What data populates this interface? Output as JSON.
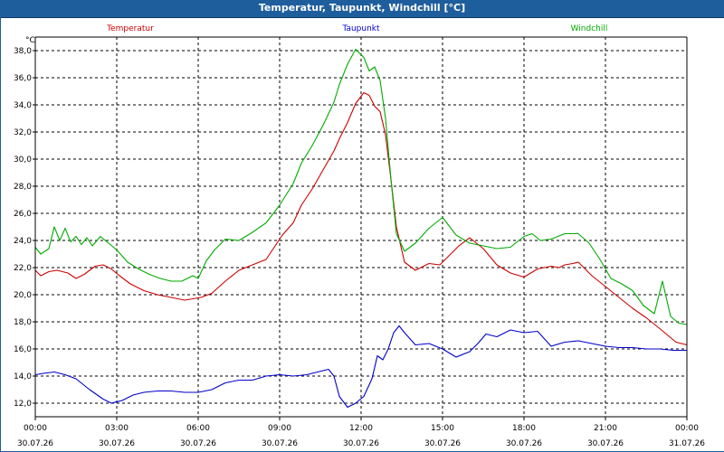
{
  "window": {
    "title": "Temperatur, Taupunkt, Windchill [°C]"
  },
  "chart_data": {
    "type": "line",
    "title": "Temperatur, Taupunkt, Windchill [°C]",
    "ylabel": "°C",
    "ylim": [
      11,
      39
    ],
    "yticks": [
      12.0,
      14.0,
      16.0,
      18.0,
      20.0,
      22.0,
      24.0,
      26.0,
      28.0,
      30.0,
      32.0,
      34.0,
      36.0,
      38.0
    ],
    "ytick_labels": [
      "12,0",
      "14,0",
      "16,0",
      "18,0",
      "20,0",
      "22,0",
      "24,0",
      "26,0",
      "28,0",
      "30,0",
      "32,0",
      "34,0",
      "36,0",
      "38,0"
    ],
    "xlim": [
      0,
      24
    ],
    "xticks": [
      0,
      3,
      6,
      9,
      12,
      15,
      18,
      21,
      24
    ],
    "xtick_time_labels": [
      "00:00",
      "03:00",
      "06:00",
      "09:00",
      "12:00",
      "15:00",
      "18:00",
      "21:00",
      "00:00"
    ],
    "xtick_date_labels": [
      "30.07.26",
      "30.07.26",
      "30.07.26",
      "30.07.26",
      "30.07.26",
      "30.07.26",
      "30.07.26",
      "30.07.26",
      "31.07.26"
    ],
    "grid": true,
    "legend_position": "top",
    "series": [
      {
        "name": "Temperatur",
        "color": "#cc0000",
        "x": [
          0,
          0.2,
          0.5,
          0.8,
          1.2,
          1.5,
          1.8,
          2.2,
          2.5,
          2.8,
          3.1,
          3.5,
          4,
          4.5,
          5,
          5.5,
          5.8,
          6.1,
          6.5,
          7,
          7.5,
          8,
          8.5,
          8.8,
          9.1,
          9.5,
          9.8,
          10.2,
          10.6,
          11,
          11.2,
          11.5,
          11.8,
          12.1,
          12.3,
          12.5,
          12.7,
          12.9,
          13.1,
          13.3,
          13.6,
          14,
          14.5,
          14.9,
          15.2,
          15.6,
          16,
          16.5,
          17,
          17.5,
          18,
          18.5,
          19,
          19.3,
          19.5,
          19.8,
          20,
          20.5,
          21,
          21.5,
          22,
          22.5,
          23,
          23.3,
          23.6,
          24
        ],
        "y": [
          21.8,
          21.4,
          21.7,
          21.8,
          21.6,
          21.2,
          21.5,
          22.1,
          22.2,
          21.9,
          21.4,
          20.8,
          20.3,
          20.0,
          19.8,
          19.6,
          19.7,
          19.8,
          20.1,
          21.0,
          21.8,
          22.2,
          22.6,
          23.5,
          24.4,
          25.3,
          26.6,
          27.8,
          29.2,
          30.6,
          31.5,
          32.7,
          34.1,
          34.9,
          34.7,
          33.9,
          33.5,
          31.8,
          28.5,
          25.0,
          22.4,
          21.8,
          22.3,
          22.2,
          22.8,
          23.6,
          24.2,
          23.4,
          22.2,
          21.6,
          21.3,
          21.9,
          22.1,
          22.0,
          22.2,
          22.3,
          22.4,
          21.4,
          20.6,
          19.8,
          19.0,
          18.3,
          17.5,
          17.0,
          16.5,
          16.3
        ]
      },
      {
        "name": "Taupunkt",
        "color": "#0000cc",
        "x": [
          0,
          0.3,
          0.7,
          1.1,
          1.5,
          2,
          2.5,
          2.8,
          3.2,
          3.6,
          4,
          4.5,
          5,
          5.5,
          6,
          6.5,
          7,
          7.5,
          8,
          8.5,
          9,
          9.5,
          10,
          10.4,
          10.8,
          11,
          11.2,
          11.5,
          11.8,
          12.1,
          12.4,
          12.6,
          12.8,
          13,
          13.2,
          13.4,
          13.6,
          14,
          14.5,
          15,
          15.5,
          16,
          16.3,
          16.6,
          17,
          17.5,
          18,
          18.5,
          19,
          19.5,
          20,
          20.5,
          21,
          21.5,
          22,
          22.5,
          23,
          23.5,
          24
        ],
        "y": [
          14.1,
          14.2,
          14.3,
          14.1,
          13.8,
          13.0,
          12.3,
          12.0,
          12.2,
          12.6,
          12.8,
          12.9,
          12.9,
          12.8,
          12.8,
          13.0,
          13.5,
          13.7,
          13.7,
          14.0,
          14.1,
          14.0,
          14.1,
          14.3,
          14.5,
          14.0,
          12.5,
          11.7,
          12.0,
          12.5,
          13.8,
          15.5,
          15.2,
          16.0,
          17.2,
          17.7,
          17.2,
          16.3,
          16.4,
          16.0,
          15.4,
          15.8,
          16.4,
          17.1,
          16.9,
          17.4,
          17.2,
          17.3,
          16.2,
          16.5,
          16.6,
          16.4,
          16.2,
          16.1,
          16.1,
          16.0,
          16.0,
          15.9,
          15.9
        ]
      },
      {
        "name": "Windchill",
        "color": "#00aa00",
        "x": [
          0,
          0.2,
          0.5,
          0.7,
          0.9,
          1.1,
          1.3,
          1.5,
          1.7,
          1.9,
          2.1,
          2.4,
          2.7,
          3,
          3.4,
          3.8,
          4.2,
          4.6,
          5,
          5.4,
          5.8,
          6,
          6.3,
          6.6,
          7,
          7.5,
          8,
          8.5,
          9,
          9.5,
          9.8,
          10.2,
          10.6,
          11,
          11.2,
          11.5,
          11.8,
          12.1,
          12.3,
          12.5,
          12.7,
          12.9,
          13.1,
          13.3,
          13.6,
          14,
          14.5,
          15,
          15.5,
          16,
          16.5,
          17,
          17.5,
          18,
          18.3,
          18.6,
          19,
          19.5,
          20,
          20.4,
          20.8,
          21.2,
          21.6,
          22,
          22.4,
          22.8,
          23.1,
          23.4,
          23.7,
          24
        ],
        "y": [
          23.5,
          23.0,
          23.4,
          25.0,
          24.0,
          24.9,
          23.9,
          24.3,
          23.7,
          24.2,
          23.6,
          24.3,
          23.8,
          23.3,
          22.4,
          21.9,
          21.5,
          21.2,
          21.0,
          21.0,
          21.4,
          21.2,
          22.5,
          23.3,
          24.1,
          24.0,
          24.6,
          25.3,
          26.6,
          28.2,
          29.7,
          31.0,
          32.5,
          34.2,
          35.5,
          37.0,
          38.1,
          37.5,
          36.5,
          36.8,
          35.8,
          33.0,
          28.5,
          24.5,
          23.2,
          23.8,
          24.9,
          25.7,
          24.4,
          23.8,
          23.6,
          23.4,
          23.5,
          24.3,
          24.5,
          24.0,
          24.1,
          24.5,
          24.5,
          23.8,
          22.6,
          21.2,
          20.8,
          20.3,
          19.2,
          18.6,
          21.0,
          18.4,
          17.9,
          17.8
        ]
      }
    ]
  }
}
